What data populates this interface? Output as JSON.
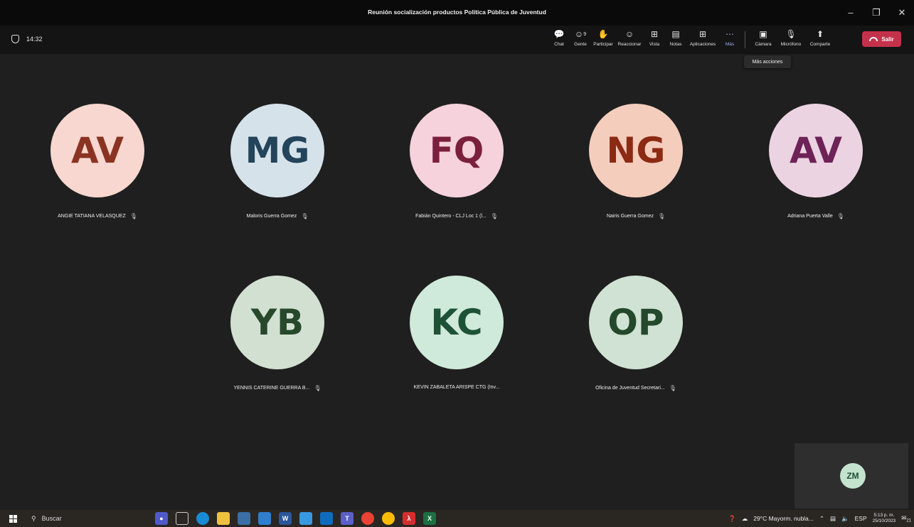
{
  "window": {
    "title": "Reunión socialización productos Política Pública de Juventud"
  },
  "meeting": {
    "elapsed": "14:32",
    "tools": [
      {
        "name": "chat",
        "label": "Chat",
        "icon": "chat-icon"
      },
      {
        "name": "people",
        "label": "Gente",
        "icon": "people-icon",
        "badge": "9"
      },
      {
        "name": "raise-hand",
        "label": "Participar",
        "icon": "hand-icon"
      },
      {
        "name": "react",
        "label": "Reaccionar",
        "icon": "smile-icon"
      },
      {
        "name": "view",
        "label": "Vista",
        "icon": "grid-icon"
      },
      {
        "name": "notes",
        "label": "Notas",
        "icon": "notes-icon"
      },
      {
        "name": "apps",
        "label": "Aplicaciones",
        "icon": "plus-icon"
      },
      {
        "name": "more",
        "label": "Más",
        "icon": "more-icon"
      }
    ],
    "device_tools": [
      {
        "name": "camera",
        "label": "Cámara",
        "icon": "camera-off-icon"
      },
      {
        "name": "mic",
        "label": "Micrófono",
        "icon": "mic-off-icon"
      },
      {
        "name": "share",
        "label": "Comparte",
        "icon": "share-icon"
      }
    ],
    "leave_label": "Salir",
    "tooltip": "Más acciones"
  },
  "participants": [
    {
      "initials": "AV",
      "name": "ANGIE TATIANA VELASQUEZ",
      "bg": "#f7d7cf",
      "fg": "#8a3322",
      "muted": true
    },
    {
      "initials": "MG",
      "name": "Maloris Guerra Gomez",
      "bg": "#d6e2ea",
      "fg": "#23445a",
      "muted": true
    },
    {
      "initials": "FQ",
      "name": "Fabián Quintero - CLJ Loc 1 (l...",
      "bg": "#f5d2dc",
      "fg": "#7a1f3d",
      "muted": true
    },
    {
      "initials": "NG",
      "name": "Nairis Guerra Gomez",
      "bg": "#f4cdbd",
      "fg": "#8c2a14",
      "muted": true
    },
    {
      "initials": "AV",
      "name": "Adriana Puerta Valle",
      "bg": "#ecd3e2",
      "fg": "#6e2257",
      "muted": true
    },
    {
      "initials": "YB",
      "name": "YENNIS CATERINE GUERRA B...",
      "bg": "#d2e0d2",
      "fg": "#27482b",
      "muted": true
    },
    {
      "initials": "KC",
      "name": "KEVIN ZABALETA ARISPE CTG (Inv...",
      "bg": "#cfe9da",
      "fg": "#1d5236",
      "muted": false
    },
    {
      "initials": "OP",
      "name": "Oficina de Juventud Secretari...",
      "bg": "#d0e2d3",
      "fg": "#24482c",
      "muted": true
    }
  ],
  "self": {
    "initials": "ZM"
  },
  "taskbar": {
    "search_label": "Buscar",
    "weather": "29°C  Mayorm. nubla...",
    "lang": "ESP",
    "time": "5:13 p. m.",
    "date": "25/10/2023",
    "notifications": "21"
  }
}
